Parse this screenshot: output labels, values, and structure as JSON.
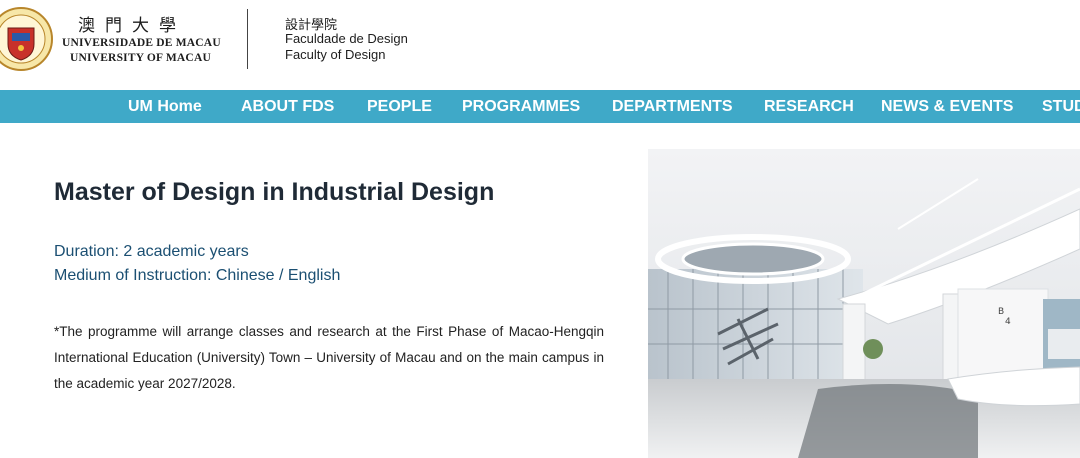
{
  "header": {
    "university_cn": "澳門大學",
    "university_pt": "UNIVERSIDADE DE MACAU",
    "university_en": "UNIVERSITY OF MACAU",
    "faculty_cn": "設計學院",
    "faculty_pt": "Faculdade de Design",
    "faculty_en": "Faculty of Design",
    "crest_icon": "university-crest-icon"
  },
  "nav": {
    "items": [
      {
        "label": "UM Home"
      },
      {
        "label": "ABOUT FDS"
      },
      {
        "label": "PEOPLE"
      },
      {
        "label": "PROGRAMMES"
      },
      {
        "label": "DEPARTMENTS"
      },
      {
        "label": "RESEARCH"
      },
      {
        "label": "NEWS & EVENTS"
      },
      {
        "label": "STUD"
      }
    ],
    "background": "#3fa9c8"
  },
  "content": {
    "title": "Master of Design in Industrial Design",
    "duration": "Duration: 2 academic years",
    "medium": "Medium of Instruction: Chinese / English",
    "note": "*The programme will arrange classes and research at the First Phase of Macao-Hengqin International Education (University) Town – University of Macau and on the main campus in the academic year 2027/2028."
  },
  "image": {
    "sign_text": "B 4"
  },
  "colors": {
    "title": "#1f2a36",
    "meta": "#1b4f72",
    "nav_text": "#ffffff"
  }
}
